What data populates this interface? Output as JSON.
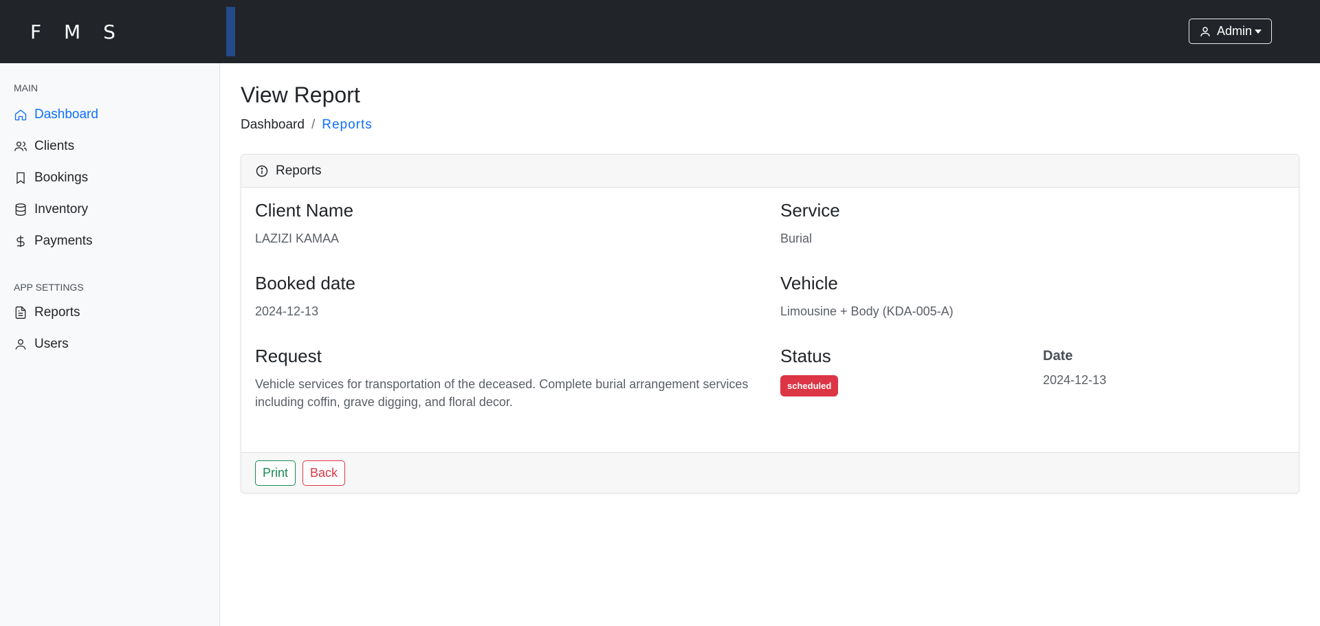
{
  "header": {
    "brand": "F M S",
    "user_menu_label": "Admin"
  },
  "sidebar": {
    "main_heading": "MAIN",
    "main_items": [
      {
        "label": "Dashboard",
        "icon": "home-icon",
        "active": true
      },
      {
        "label": "Clients",
        "icon": "users-icon"
      },
      {
        "label": "Bookings",
        "icon": "bookmark-icon"
      },
      {
        "label": "Inventory",
        "icon": "database-icon"
      },
      {
        "label": "Payments",
        "icon": "dollar-icon"
      }
    ],
    "settings_heading": "APP SETTINGS",
    "settings_items": [
      {
        "label": "Reports",
        "icon": "file-text-icon"
      },
      {
        "label": "Users",
        "icon": "user-icon"
      }
    ]
  },
  "page": {
    "title": "View Report",
    "breadcrumb": {
      "home": "Dashboard",
      "separator": "/",
      "current": "Reports"
    }
  },
  "card": {
    "header": "Reports",
    "fields": {
      "client_name": {
        "label": "Client Name",
        "value": "LAZIZI KAMAA"
      },
      "service": {
        "label": "Service",
        "value": "Burial"
      },
      "booked_date": {
        "label": "Booked date",
        "value": "2024-12-13"
      },
      "vehicle": {
        "label": "Vehicle",
        "value": "Limousine + Body (KDA-005-A)"
      },
      "request": {
        "label": "Request",
        "value": "Vehicle services for transportation of the deceased. Complete burial arrangement services including coffin, grave digging, and floral decor."
      },
      "status": {
        "label": "Status",
        "value": "scheduled"
      },
      "date": {
        "label": "Date",
        "value": "2024-12-13"
      }
    },
    "buttons": {
      "print": "Print",
      "back": "Back"
    }
  },
  "colors": {
    "topbar": "#212529",
    "accent": "#234a8a",
    "link": "#0d6efd",
    "status_badge": "#dc3545",
    "print": "#198754",
    "back": "#dc3545"
  }
}
